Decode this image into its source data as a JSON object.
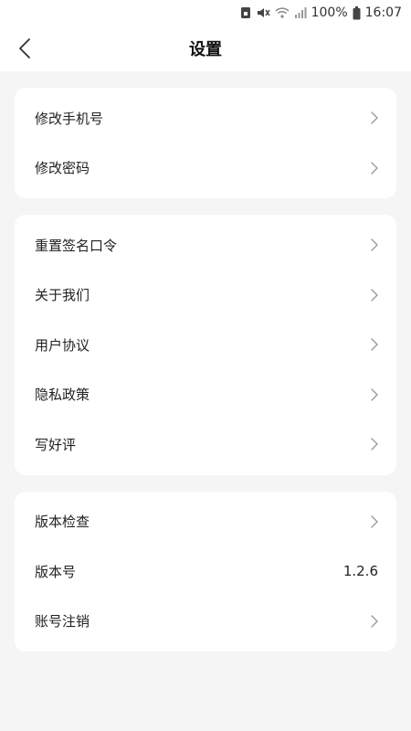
{
  "status": {
    "battery": "100%",
    "time": "16:07"
  },
  "header": {
    "title": "设置"
  },
  "groups": [
    {
      "items": [
        {
          "label": "修改手机号"
        },
        {
          "label": "修改密码"
        }
      ]
    },
    {
      "items": [
        {
          "label": "重置签名口令"
        },
        {
          "label": "关于我们"
        },
        {
          "label": "用户协议"
        },
        {
          "label": "隐私政策"
        },
        {
          "label": "写好评"
        }
      ]
    },
    {
      "items": [
        {
          "label": "版本检查"
        },
        {
          "label": "版本号",
          "value": "1.2.6"
        },
        {
          "label": "账号注销"
        }
      ]
    }
  ],
  "icons": {
    "back": "chevron-left-icon",
    "row_arrow": "chevron-right-icon"
  },
  "colors": {
    "background": "#f5f5f5",
    "card": "#ffffff",
    "text": "#222222",
    "arrow": "#9a9a9a"
  }
}
